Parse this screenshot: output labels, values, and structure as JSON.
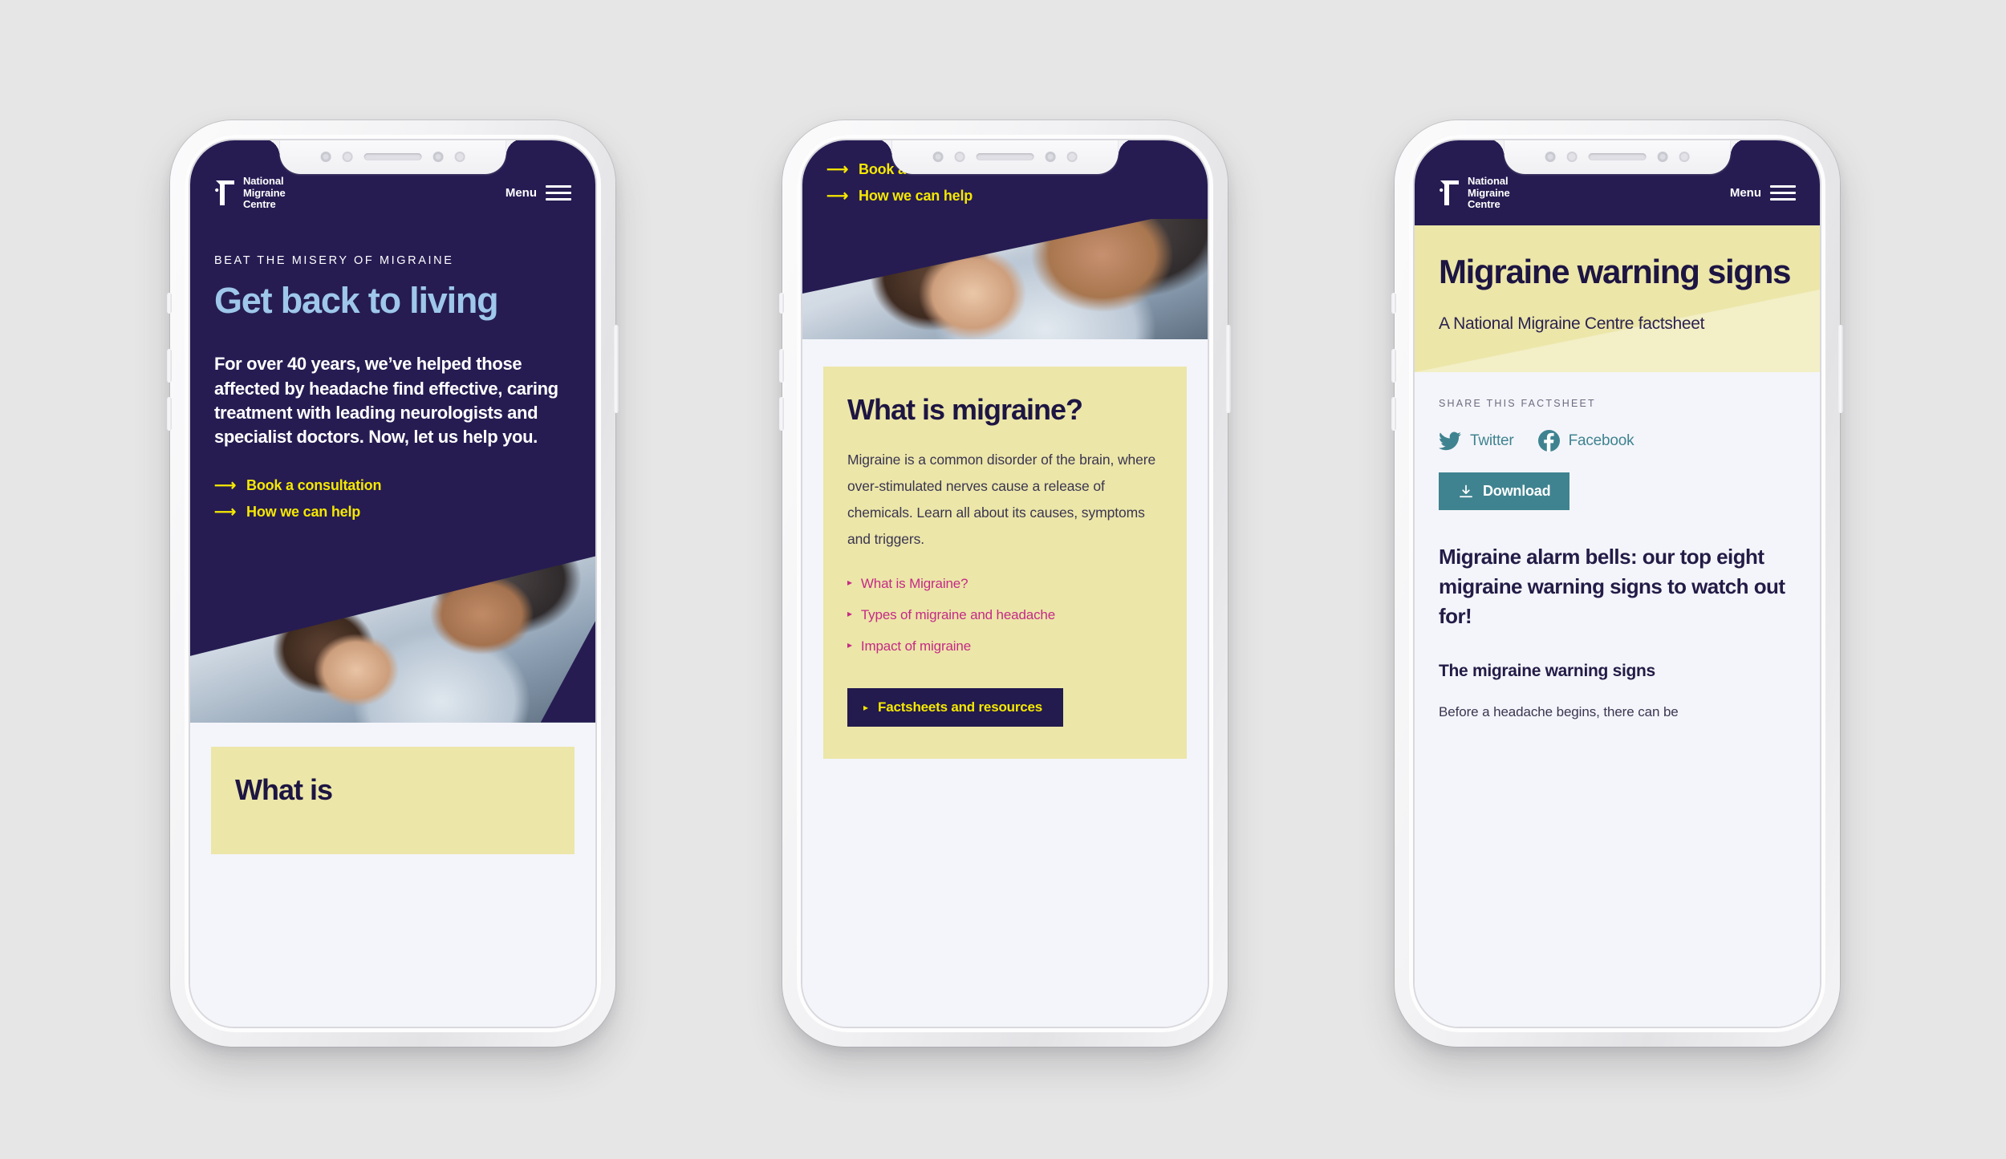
{
  "brand": {
    "navy": "#261c52",
    "yellow": "#ece6a9",
    "highlight_yellow": "#f5e800",
    "light_blue": "#9ec7ea",
    "pink": "#c52a86",
    "teal": "#3f8390",
    "logo_name": "National\nMigraine\nCentre",
    "logo_icon": "nmc-logo-icon"
  },
  "nav": {
    "menu_label": "Menu",
    "burger_icon": "hamburger-menu-icon"
  },
  "phone1": {
    "eyebrow": "BEAT THE MISERY OF MIGRAINE",
    "title": "Get back to living",
    "body": "For over 40 years, we’ve helped those affected by headache find effective, caring treatment with leading neurologists and specialist doctors. Now, let us help you.",
    "links": [
      {
        "label": "Book a consultation",
        "icon": "arrow-right-icon"
      },
      {
        "label": "How we can help",
        "icon": "arrow-right-icon"
      }
    ],
    "photo_alt": "woman-with-glasses-hugging-girl-photo",
    "card_title": "What is"
  },
  "phone2": {
    "links": [
      {
        "label": "Book a consultation",
        "icon": "arrow-right-icon"
      },
      {
        "label": "How we can help",
        "icon": "arrow-right-icon"
      }
    ],
    "photo_alt": "woman-with-glasses-hugging-girl-photo",
    "card_title": "What is migraine?",
    "card_body": "Migraine is a common disorder of the brain, where over-stimulated nerves cause a release of chemicals. Learn all about its causes, symptoms and triggers.",
    "topic_links": [
      {
        "label": "What is Migraine?",
        "icon": "triangle-right-icon"
      },
      {
        "label": "Types of migraine and headache",
        "icon": "triangle-right-icon"
      },
      {
        "label": "Impact of migraine",
        "icon": "triangle-right-icon"
      }
    ],
    "cta": {
      "label": "Factsheets and resources",
      "icon": "triangle-right-icon"
    }
  },
  "phone3": {
    "banner_title": "Migraine warning signs",
    "banner_sub": "A National Migraine Centre factsheet",
    "share_label": "SHARE THIS FACTSHEET",
    "share": [
      {
        "label": "Twitter",
        "icon": "twitter-icon"
      },
      {
        "label": "Facebook",
        "icon": "facebook-icon"
      }
    ],
    "download": {
      "label": "Download",
      "icon": "download-icon"
    },
    "heading": "Migraine alarm bells: our top eight migraine warning signs to watch out for!",
    "subheading": "The migraine warning signs",
    "paragraph": "Before a headache begins, there can be"
  }
}
